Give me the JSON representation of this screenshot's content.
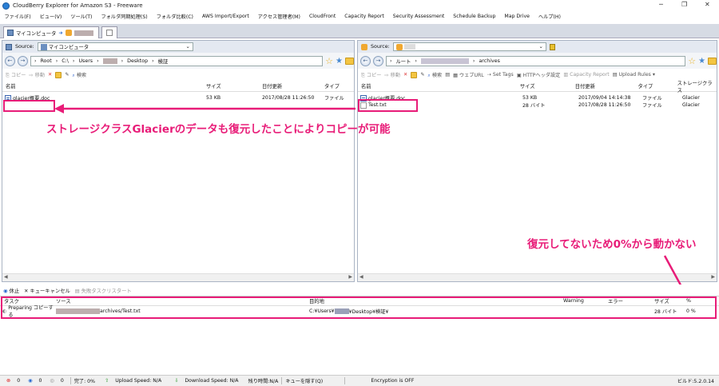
{
  "window": {
    "title": "CloudBerry Explorer for Amazon S3 - Freeware"
  },
  "menu": [
    "ファイル(F)",
    "ビュー(V)",
    "ツール(T)",
    "フォルダ同期処理(S)",
    "フォルダ比較(C)",
    "AWS Import/Export",
    "アクセス管理者(M)",
    "CloudFront",
    "Capacity Report",
    "Security Assessment",
    "Schedule Backup",
    "Map Drive",
    "ヘルプ(H)"
  ],
  "tabs": {
    "main": "マイコンピュータ",
    "arrow": "➜"
  },
  "left": {
    "source_label": "Source:",
    "source_value": "マイコンピュータ",
    "path": [
      "Root",
      "C:\\",
      "Users",
      "Desktop",
      "検証"
    ],
    "toolbar": [
      "コピー",
      "移動",
      "削除",
      "検索"
    ],
    "columns": [
      "名前",
      "サイズ",
      "日付更新",
      "タイプ"
    ],
    "files": [
      {
        "name": "glacier概要.doc",
        "size": "53 KB",
        "date": "2017/08/28 11:26:50",
        "type": "ファイル"
      }
    ]
  },
  "right": {
    "source_label": "Source:",
    "path": [
      "ルート",
      "archives"
    ],
    "toolbar": [
      "コピー",
      "移動",
      "削除",
      "検索",
      "ウェブURL",
      "Set Tags",
      "HTTPヘッダ設定",
      "Capacity Report",
      "Upload Rules"
    ],
    "columns": [
      "名前",
      "サイズ",
      "日付更新",
      "タイプ",
      "ストレージクラス"
    ],
    "files": [
      {
        "name": "glacier概要.doc",
        "size": "53 KB",
        "date": "2017/09/04 14:14:38",
        "type": "ファイル",
        "storage": "Glacier"
      },
      {
        "name": "Test.txt",
        "size": "28 バイト",
        "date": "2017/08/28 11:26:50",
        "type": "ファイル",
        "storage": "Glacier"
      }
    ]
  },
  "queue": {
    "toolbar": [
      "休止",
      "キューキャンセル",
      "失敗タスクリスタート"
    ],
    "columns": [
      "タスク",
      "ソース",
      "目的地",
      "Warning",
      "エラー",
      "サイズ",
      "%"
    ],
    "rows": [
      {
        "task": "Preparing コピーする",
        "source": "archives/Test.txt",
        "dest_prefix": "C:¥Users¥",
        "dest_suffix": "¥Desktop¥検証¥",
        "size": "28 バイト",
        "pct": "0 %"
      }
    ]
  },
  "annotations": {
    "copy_note": "ストレージクラスGlacierのデータも復元したことによりコピーが可能",
    "stuck_note": "復元してないため0%から動かない"
  },
  "status": {
    "counts": [
      "0",
      "0",
      "0"
    ],
    "done": "完了: 0%",
    "upload": "Upload Speed: N/A",
    "download": "Download Speed: N/A",
    "remaining": "残り時間:N/A",
    "hide_queue": "キューを隠す(Q)",
    "encryption": "Encryption is OFF",
    "build": "ビルド:5.2.0.14"
  },
  "colors": {
    "accent": "#e81c78",
    "pane_header": "#e4e9f1"
  }
}
